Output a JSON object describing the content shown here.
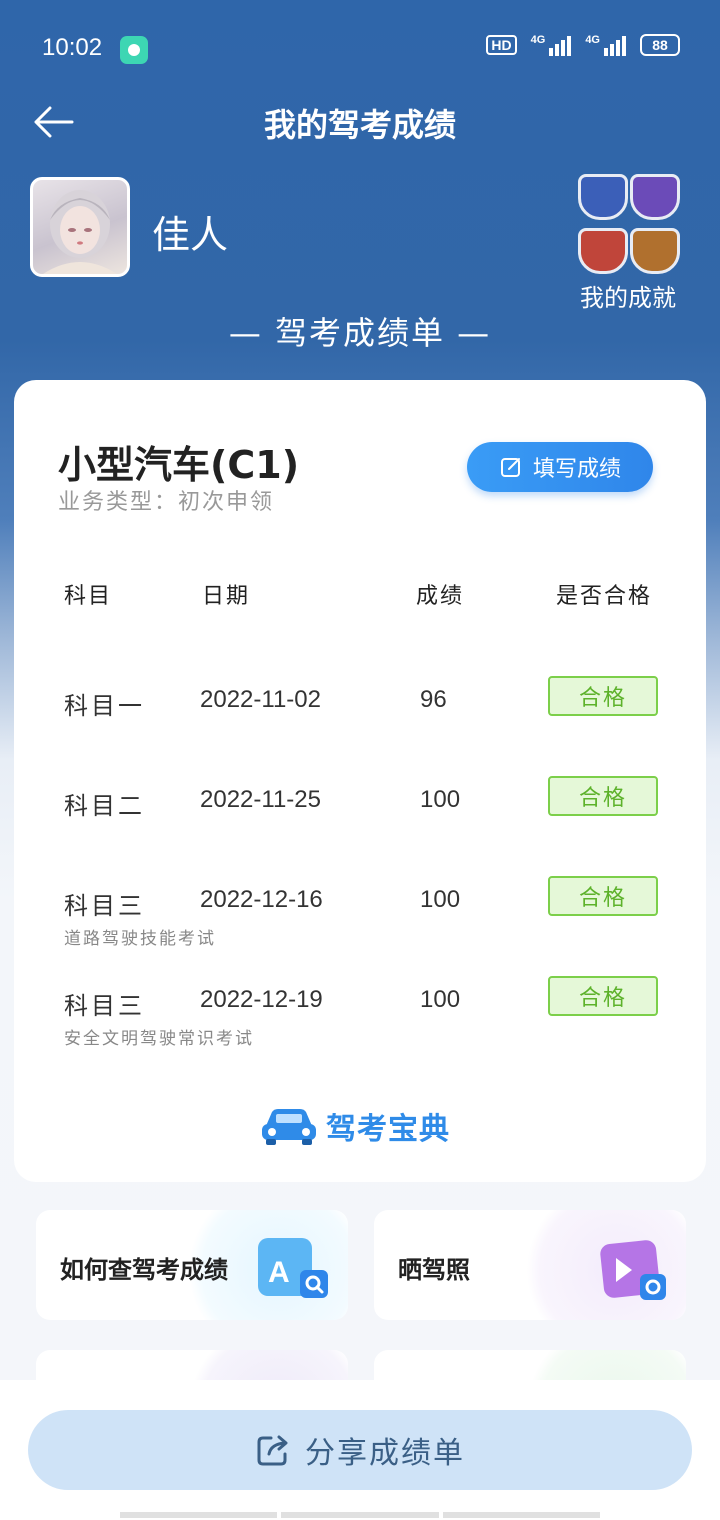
{
  "status": {
    "time": "10:02",
    "hd": "HD",
    "network1": "4G",
    "network2": "4G",
    "battery": "88"
  },
  "header": {
    "title": "我的驾考成绩"
  },
  "user": {
    "name": "佳人"
  },
  "achievements": {
    "label": "我的成就",
    "colors": [
      "#3b5fb8",
      "#6b4bb8",
      "#c0453a",
      "#b0702e"
    ]
  },
  "banner": {
    "text": "— 驾考成绩单 —"
  },
  "scorecard": {
    "vehicle": "小型汽车(C1)",
    "business_type": "业务类型：初次申领",
    "fill_button": "填写成绩",
    "columns": [
      "科目",
      "日期",
      "成绩",
      "是否合格"
    ],
    "rows": [
      {
        "subject": "科目一",
        "date": "2022-11-02",
        "score": "96",
        "result": "合格",
        "note": ""
      },
      {
        "subject": "科目二",
        "date": "2022-11-25",
        "score": "100",
        "result": "合格",
        "note": ""
      },
      {
        "subject": "科目三",
        "date": "2022-12-16",
        "score": "100",
        "result": "合格",
        "note": "道路驾驶技能考试"
      },
      {
        "subject": "科目三",
        "date": "2022-12-19",
        "score": "100",
        "result": "合格",
        "note": "安全文明驾驶常识考试"
      }
    ],
    "brand": "驾考宝典"
  },
  "features": [
    {
      "label": "如何查驾考成绩",
      "icon": "search-document-icon",
      "accent": "#5cb6f4"
    },
    {
      "label": "晒驾照",
      "icon": "photo-share-icon",
      "accent": "#b575e6"
    }
  ],
  "footer": {
    "share_label": "分享成绩单"
  },
  "colors": {
    "header_bg": "#2f66aa",
    "primary": "#2f86ea",
    "pass_green": "#5db22b"
  }
}
